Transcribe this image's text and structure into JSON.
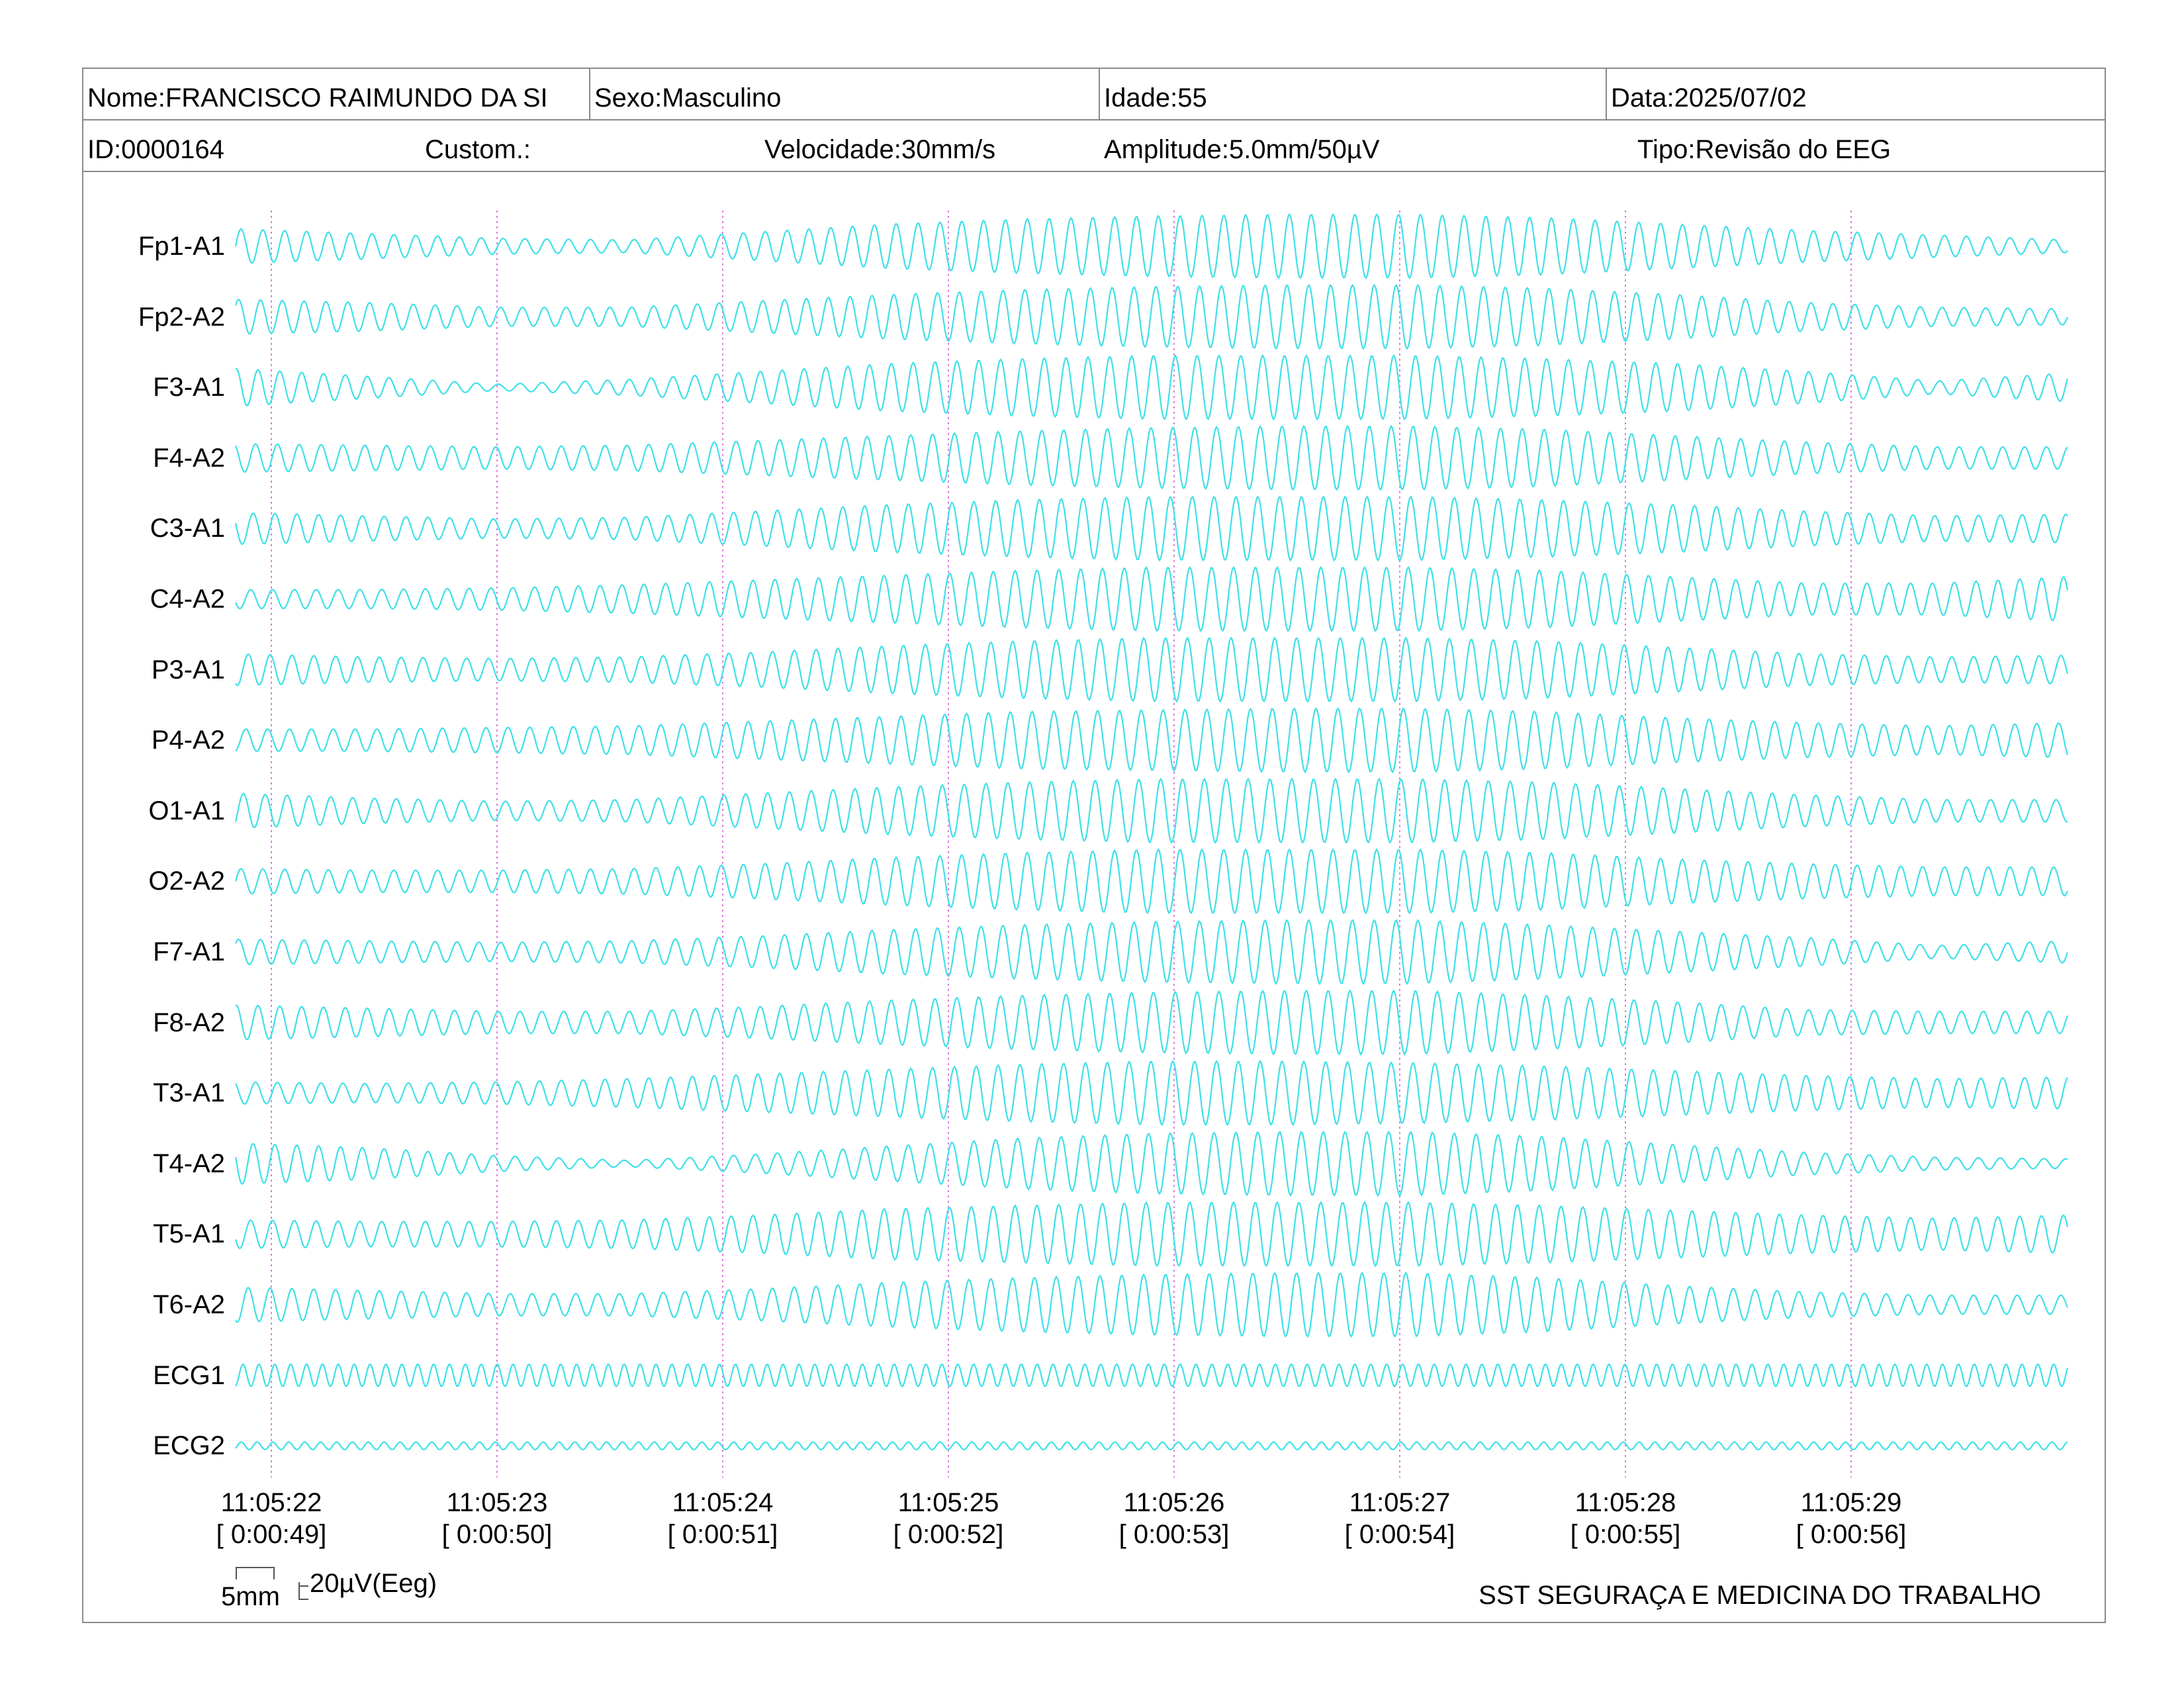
{
  "header": {
    "name": "Nome:FRANCISCO RAIMUNDO DA SI",
    "sex": "Sexo:Masculino",
    "age": "Idade:55",
    "date": "Data:2025/07/02",
    "id": "ID:0000164",
    "custom": "Custom.:",
    "speed": "Velocidade:30mm/s",
    "amplitude": "Amplitude:5.0mm/50µV",
    "type": "Tipo:Revisão do EEG"
  },
  "channels": [
    {
      "label": "Fp1-A1",
      "env": [
        0.55,
        0.4,
        0.25,
        0.2,
        0.45,
        0.7,
        0.85,
        0.95,
        1.0,
        1.0,
        0.9,
        0.7,
        0.5,
        0.35,
        0.2
      ]
    },
    {
      "label": "Fp2-A2",
      "env": [
        0.55,
        0.45,
        0.3,
        0.3,
        0.5,
        0.7,
        0.85,
        0.95,
        1.0,
        1.0,
        0.9,
        0.7,
        0.45,
        0.3,
        0.25
      ]
    },
    {
      "label": "F3-A1",
      "env": [
        0.6,
        0.35,
        0.1,
        0.25,
        0.5,
        0.75,
        0.9,
        1.0,
        1.0,
        1.0,
        0.9,
        0.75,
        0.5,
        0.2,
        0.45
      ]
    },
    {
      "label": "F4-A2",
      "env": [
        0.45,
        0.4,
        0.35,
        0.4,
        0.55,
        0.7,
        0.85,
        0.95,
        1.0,
        1.0,
        0.9,
        0.7,
        0.5,
        0.35,
        0.35
      ]
    },
    {
      "label": "C3-A1",
      "env": [
        0.5,
        0.4,
        0.3,
        0.35,
        0.55,
        0.75,
        0.9,
        1.0,
        1.0,
        1.0,
        0.9,
        0.75,
        0.55,
        0.4,
        0.45
      ]
    },
    {
      "label": "C4-A2",
      "env": [
        0.3,
        0.3,
        0.35,
        0.45,
        0.6,
        0.75,
        0.9,
        1.0,
        1.0,
        1.0,
        0.9,
        0.7,
        0.5,
        0.5,
        0.7
      ]
    },
    {
      "label": "P3-A1",
      "env": [
        0.5,
        0.4,
        0.35,
        0.4,
        0.55,
        0.75,
        0.9,
        1.0,
        1.0,
        1.0,
        0.9,
        0.7,
        0.5,
        0.4,
        0.45
      ]
    },
    {
      "label": "P4-A2",
      "env": [
        0.35,
        0.35,
        0.4,
        0.45,
        0.6,
        0.75,
        0.9,
        0.95,
        1.0,
        1.0,
        0.9,
        0.7,
        0.55,
        0.45,
        0.55
      ]
    },
    {
      "label": "O1-A1",
      "env": [
        0.55,
        0.4,
        0.3,
        0.35,
        0.55,
        0.75,
        0.9,
        1.0,
        1.0,
        1.0,
        0.9,
        0.7,
        0.5,
        0.35,
        0.35
      ]
    },
    {
      "label": "O2-A2",
      "env": [
        0.4,
        0.35,
        0.35,
        0.4,
        0.55,
        0.75,
        0.9,
        1.0,
        1.0,
        1.0,
        0.9,
        0.7,
        0.55,
        0.45,
        0.45
      ]
    },
    {
      "label": "F7-A1",
      "env": [
        0.4,
        0.35,
        0.3,
        0.35,
        0.5,
        0.7,
        0.85,
        0.95,
        1.0,
        1.0,
        0.85,
        0.65,
        0.45,
        0.2,
        0.35
      ]
    },
    {
      "label": "F8-A2",
      "env": [
        0.55,
        0.45,
        0.35,
        0.35,
        0.5,
        0.7,
        0.85,
        0.95,
        1.0,
        1.0,
        0.85,
        0.65,
        0.4,
        0.35,
        0.35
      ]
    },
    {
      "label": "T3-A1",
      "env": [
        0.35,
        0.3,
        0.35,
        0.45,
        0.6,
        0.75,
        0.9,
        1.0,
        1.0,
        0.95,
        0.85,
        0.7,
        0.55,
        0.45,
        0.5
      ]
    },
    {
      "label": "T4-A2",
      "env": [
        0.65,
        0.5,
        0.25,
        0.1,
        0.3,
        0.55,
        0.8,
        0.95,
        1.0,
        1.0,
        0.85,
        0.6,
        0.35,
        0.2,
        0.15
      ]
    },
    {
      "label": "T5-A1",
      "env": [
        0.45,
        0.4,
        0.4,
        0.45,
        0.6,
        0.8,
        0.9,
        1.0,
        1.0,
        1.0,
        0.9,
        0.75,
        0.6,
        0.5,
        0.6
      ]
    },
    {
      "label": "T6-A2",
      "env": [
        0.55,
        0.45,
        0.35,
        0.35,
        0.5,
        0.7,
        0.85,
        0.95,
        1.0,
        1.0,
        0.85,
        0.6,
        0.4,
        0.3,
        0.3
      ]
    },
    {
      "label": "ECG1",
      "env": [
        0.35,
        0.35,
        0.35,
        0.35,
        0.35,
        0.35,
        0.35,
        0.35,
        0.35,
        0.35,
        0.35,
        0.35,
        0.35,
        0.35,
        0.35
      ]
    },
    {
      "label": "ECG2",
      "env": [
        0.12,
        0.12,
        0.12,
        0.12,
        0.12,
        0.12,
        0.12,
        0.12,
        0.12,
        0.12,
        0.12,
        0.12,
        0.12,
        0.12,
        0.12
      ]
    }
  ],
  "time_marks": [
    {
      "clock": "11:05:22",
      "offset": "[ 0:00:49]"
    },
    {
      "clock": "11:05:23",
      "offset": "[ 0:00:50]"
    },
    {
      "clock": "11:05:24",
      "offset": "[ 0:00:51]"
    },
    {
      "clock": "11:05:25",
      "offset": "[ 0:00:52]"
    },
    {
      "clock": "11:05:26",
      "offset": "[ 0:00:53]"
    },
    {
      "clock": "11:05:27",
      "offset": "[ 0:00:54]"
    },
    {
      "clock": "11:05:28",
      "offset": "[ 0:00:55]"
    },
    {
      "clock": "11:05:29",
      "offset": "[ 0:00:56]"
    }
  ],
  "scale": {
    "time": "5mm",
    "amplitude": "20µV(Eeg)"
  },
  "footer": "SST SEGURAÇA E MEDICINA DO TRABALHO",
  "colors": {
    "trace": "#3fe0e8",
    "second_marker": "#e07ae0",
    "border": "#8a8a8a"
  }
}
